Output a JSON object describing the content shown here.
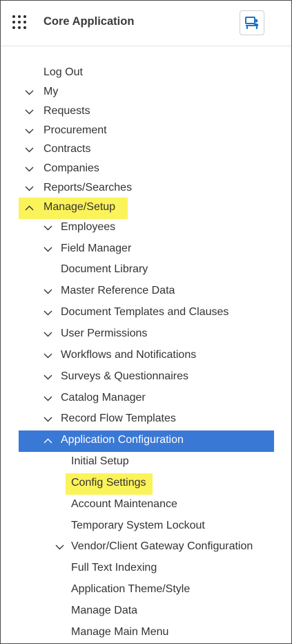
{
  "header": {
    "app_title": "Core Application"
  },
  "menu": {
    "items": [
      {
        "label": "Log Out",
        "level": 0,
        "chevron": "none"
      },
      {
        "label": "My",
        "level": 0,
        "chevron": "down"
      },
      {
        "label": "Requests",
        "level": 0,
        "chevron": "down"
      },
      {
        "label": "Procurement",
        "level": 0,
        "chevron": "down"
      },
      {
        "label": "Contracts",
        "level": 0,
        "chevron": "down"
      },
      {
        "label": "Companies",
        "level": 0,
        "chevron": "down"
      },
      {
        "label": "Reports/Searches",
        "level": 0,
        "chevron": "down"
      },
      {
        "label": "Manage/Setup",
        "level": 0,
        "chevron": "up",
        "highlight": "yellow"
      },
      {
        "label": "Employees",
        "level": 1,
        "chevron": "down"
      },
      {
        "label": "Field Manager",
        "level": 1,
        "chevron": "down"
      },
      {
        "label": "Document Library",
        "level": 1,
        "chevron": "none"
      },
      {
        "label": "Master Reference Data",
        "level": 1,
        "chevron": "down"
      },
      {
        "label": "Document Templates and Clauses",
        "level": 1,
        "chevron": "down"
      },
      {
        "label": "User Permissions",
        "level": 1,
        "chevron": "down"
      },
      {
        "label": "Workflows and Notifications",
        "level": 1,
        "chevron": "down"
      },
      {
        "label": "Surveys & Questionnaires",
        "level": 1,
        "chevron": "down"
      },
      {
        "label": "Catalog Manager",
        "level": 1,
        "chevron": "down"
      },
      {
        "label": "Record Flow Templates",
        "level": 1,
        "chevron": "down"
      },
      {
        "label": "Application Configuration",
        "level": 1,
        "chevron": "up",
        "highlight": "blue"
      },
      {
        "label": "Initial Setup",
        "level": 2,
        "chevron": "none"
      },
      {
        "label": "Config Settings",
        "level": 2,
        "chevron": "none",
        "highlight": "yellow"
      },
      {
        "label": "Account Maintenance",
        "level": 2,
        "chevron": "none"
      },
      {
        "label": "Temporary System Lockout",
        "level": 2,
        "chevron": "none"
      },
      {
        "label": "Vendor/Client Gateway Configuration",
        "level": 2,
        "chevron": "down"
      },
      {
        "label": "Full Text Indexing",
        "level": 2,
        "chevron": "none"
      },
      {
        "label": "Application Theme/Style",
        "level": 2,
        "chevron": "none"
      },
      {
        "label": "Manage Data",
        "level": 2,
        "chevron": "none"
      },
      {
        "label": "Manage Main Menu",
        "level": 2,
        "chevron": "none"
      }
    ]
  },
  "colors": {
    "highlight_yellow": "#fbf35a",
    "active_blue": "#3a78d6",
    "user_icon": "#1a73c9"
  },
  "icons": {
    "apps": "apps-grid-icon",
    "user": "user-desk-icon"
  }
}
